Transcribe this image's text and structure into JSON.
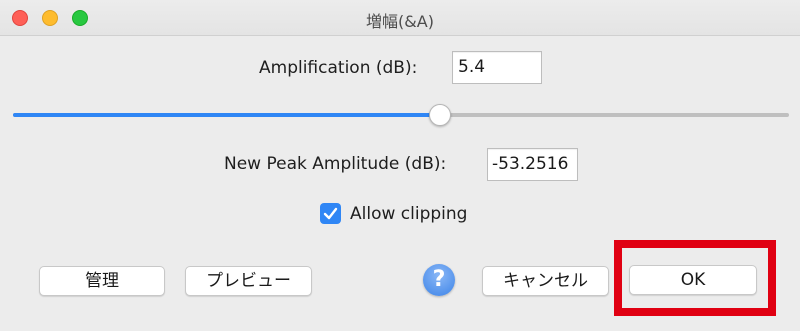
{
  "window": {
    "title": "増幅(&A)"
  },
  "amplification": {
    "label": "Amplification (dB):",
    "value": "5.4"
  },
  "slider": {
    "level_fraction": 0.55,
    "accent_color": "#2f86f5"
  },
  "new_peak": {
    "label": "New Peak Amplitude (dB):",
    "value": "-53.2516"
  },
  "clipping": {
    "label": "Allow clipping",
    "checked": true
  },
  "buttons": {
    "manage": "管理",
    "preview": "プレビュー",
    "help": "?",
    "cancel": "キャンセル",
    "ok": "OK"
  },
  "highlight_color": "#e00012"
}
